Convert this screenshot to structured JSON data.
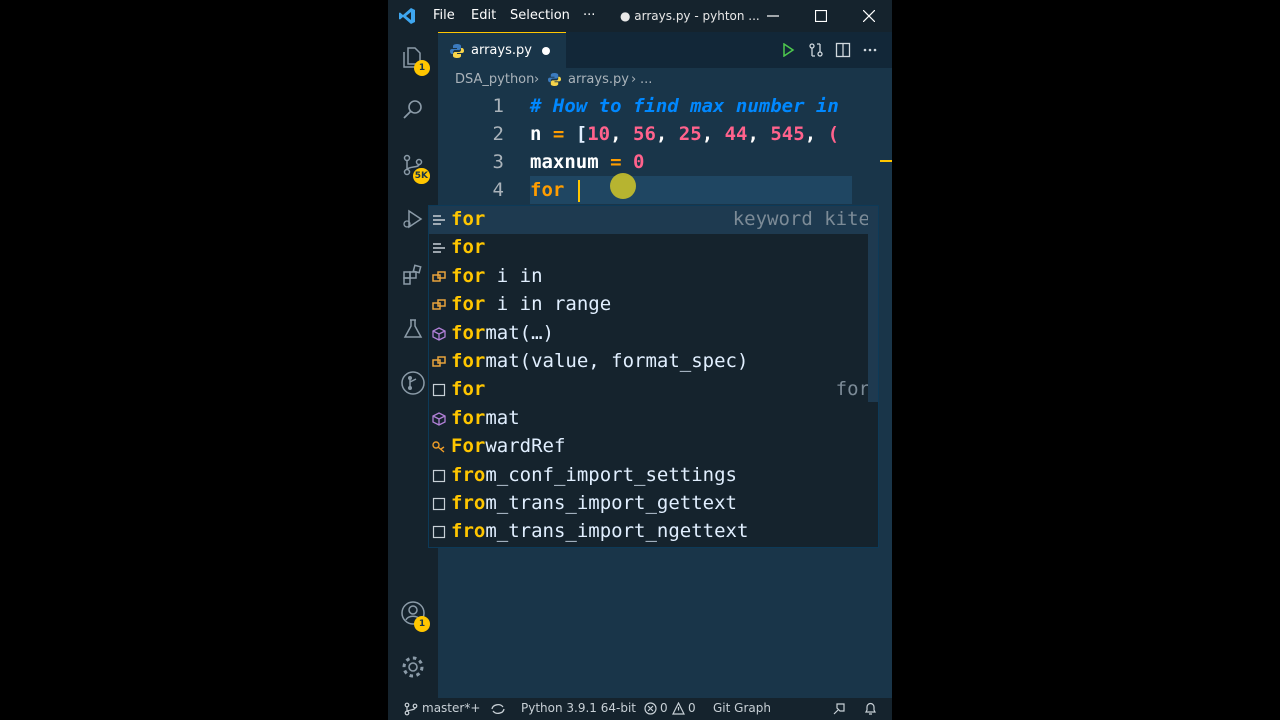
{
  "titlebar": {
    "menu": [
      "File",
      "Edit",
      "Selection",
      "···"
    ],
    "window_title": "● arrays.py - pyhton ...",
    "icons": [
      "vscode-logo-icon",
      "minimize-icon",
      "maximize-icon",
      "close-icon"
    ]
  },
  "activity_bar": {
    "explorer_badge": "1",
    "source_control_badge": "5K",
    "accounts_badge": "1"
  },
  "tab": {
    "label": "arrays.py"
  },
  "breadcrumb": {
    "folder": "DSA_python",
    "file": "arrays.py",
    "more": "..."
  },
  "editor": {
    "line_numbers": [
      "1",
      "2",
      "3",
      "4"
    ],
    "line1": "# How to find max number in",
    "line2_n": "n",
    "line2_eq": " = ",
    "line2_open": "[",
    "line2_nums": [
      "10",
      "56",
      "25",
      "44",
      "545",
      "("
    ],
    "line2_commas": ", ",
    "line3_var": "maxnum",
    "line3_eq": " = ",
    "line3_val": "0",
    "line4_kw": "for "
  },
  "suggestions": [
    {
      "match": "for",
      "rest": "",
      "detail": "keyword kite",
      "icon": "keyword-icon"
    },
    {
      "match": "for",
      "rest": "",
      "detail": "",
      "icon": "keyword-icon"
    },
    {
      "match": "for",
      "rest": " i in",
      "detail": "",
      "icon": "snippet-icon"
    },
    {
      "match": "for",
      "rest": " i in range",
      "detail": "",
      "icon": "snippet-icon"
    },
    {
      "match": "for",
      "rest": "mat(…)",
      "detail": "",
      "icon": "method-icon"
    },
    {
      "match": "for",
      "rest": "mat(value, format_spec)",
      "detail": "",
      "icon": "snippet-icon"
    },
    {
      "match": "for",
      "rest": "",
      "detail": "for",
      "icon": "text-icon"
    },
    {
      "match": "for",
      "rest": "mat",
      "detail": "",
      "icon": "method-icon"
    },
    {
      "match": "For",
      "rest": "wardRef",
      "detail": "",
      "icon": "class-icon"
    },
    {
      "match": "fro",
      "rest": "m_conf_import_settings",
      "detail": "",
      "icon": "text-icon"
    },
    {
      "match": "fro",
      "rest": "m_trans_import_gettext",
      "detail": "",
      "icon": "text-icon"
    },
    {
      "match": "fro",
      "rest": "m_trans_import_ngettext",
      "detail": "",
      "icon": "text-icon"
    }
  ],
  "statusbar": {
    "branch": "master*+",
    "python": "Python 3.9.1 64-bit",
    "errors": "0",
    "warnings": "0",
    "git_graph": "Git Graph"
  },
  "colors": {
    "background": "#193549",
    "accent": "#ffc600",
    "comment": "#0088ff",
    "number": "#ff628c",
    "keyword": "#ff9d00"
  }
}
